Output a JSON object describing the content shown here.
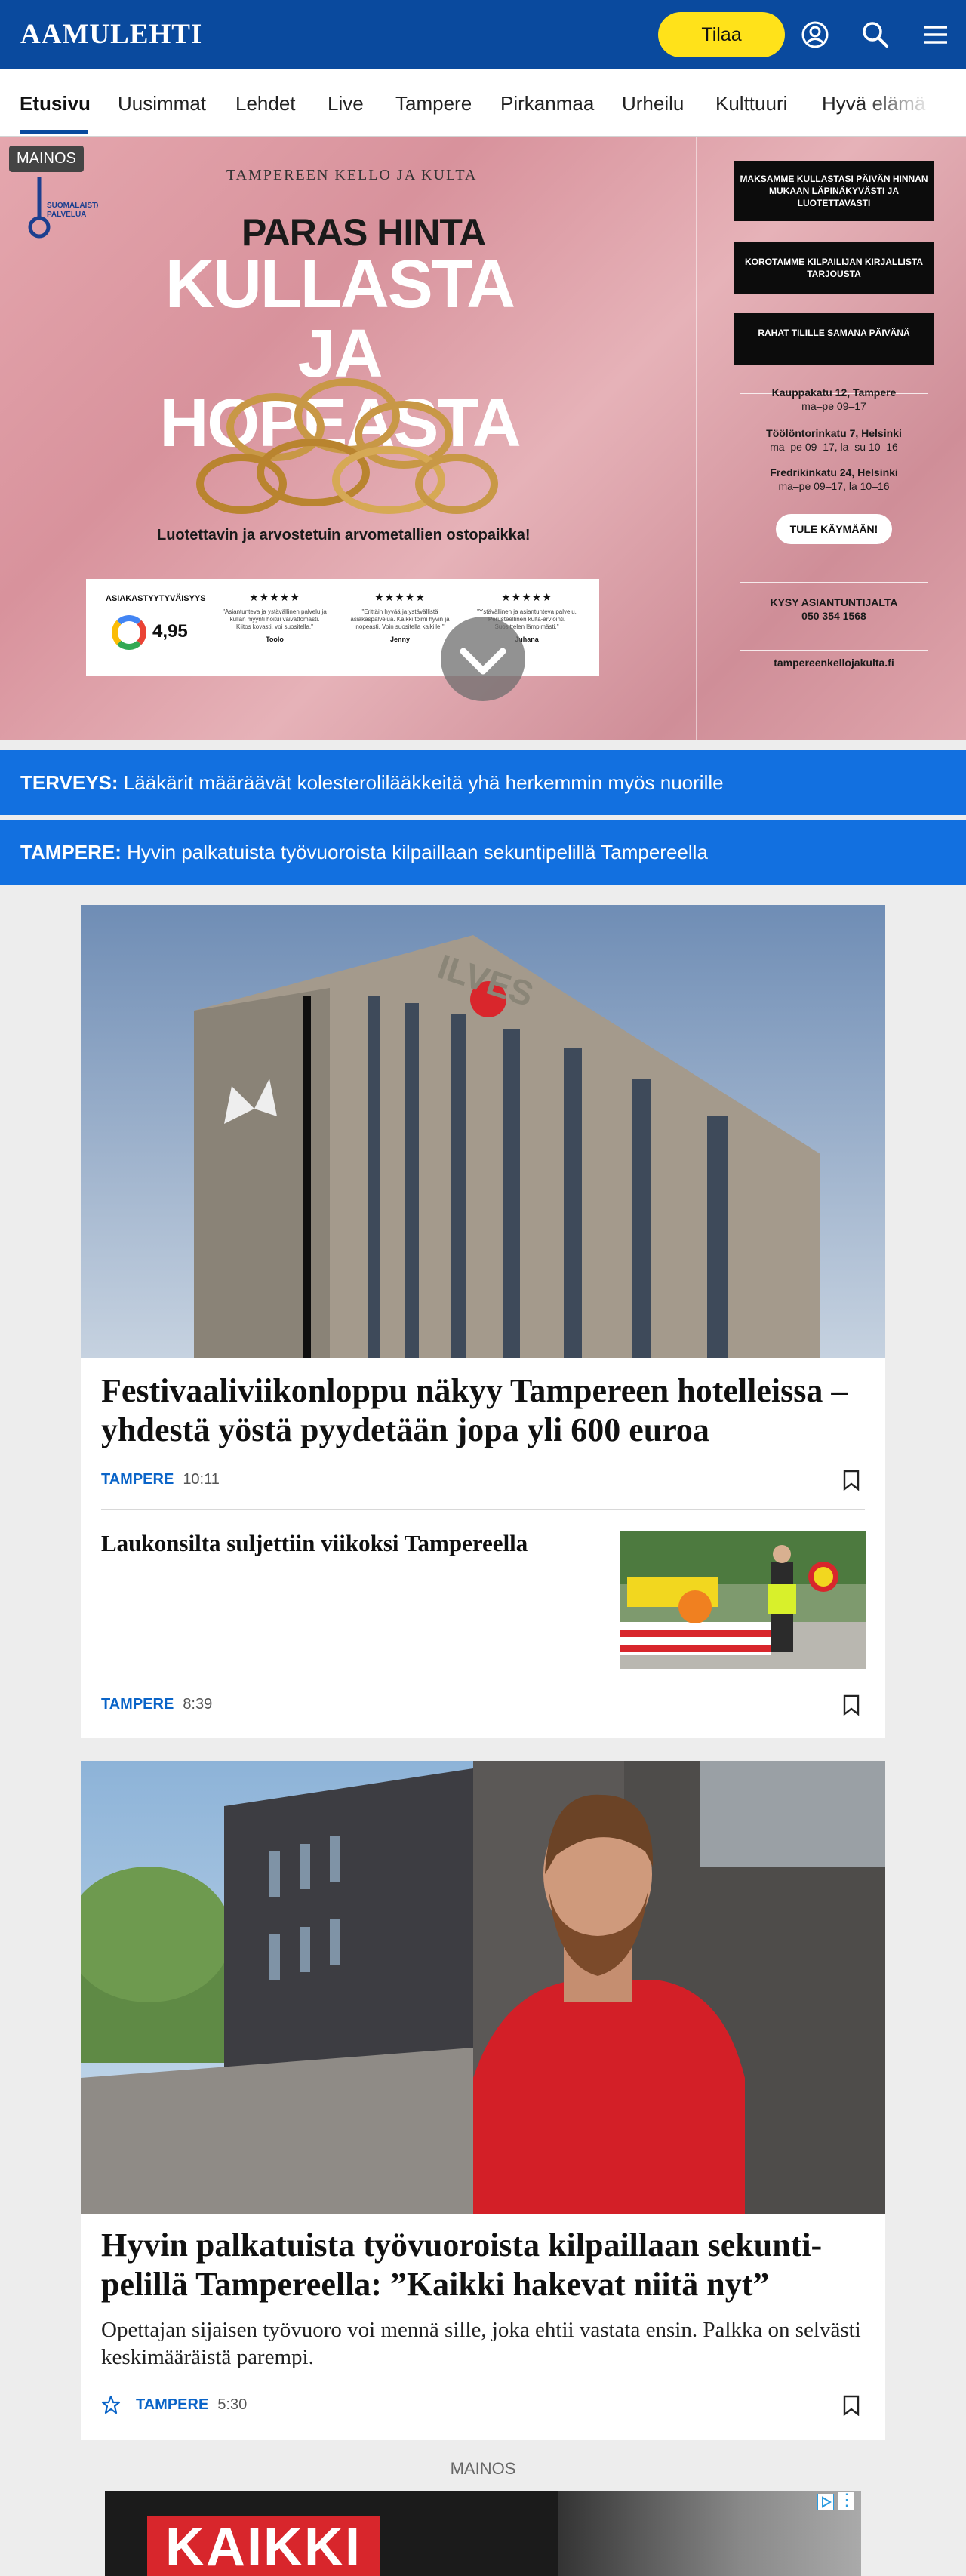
{
  "header": {
    "logo": "AAMULEHTI",
    "subscribe_label": "Tilaa",
    "icons": [
      "user-icon",
      "search-icon",
      "menu-icon"
    ]
  },
  "nav": {
    "items": [
      "Etusivu",
      "Uusimmat",
      "Lehdet",
      "Live",
      "Tampere",
      "Pirkanmaa",
      "Urheilu",
      "Kulttuuri",
      "Hyvä elämä"
    ],
    "active": "Etusivu"
  },
  "ad": {
    "label": "MAINOS",
    "seal_text": [
      "SUOMALAISTA",
      "PALVELUA"
    ],
    "brand": "TAMPEREEN KELLO JA KULTA",
    "headline_small": "PARAS HINTA",
    "headline_big_1": "KULLASTA",
    "headline_big_2": "JA HOPEASTA",
    "tagline": "Luotettavin ja arvostetuin arvometallien ostopaikka!",
    "reviews": {
      "title": "ASIAKASTYYTYVÄISYYS",
      "score": "4,95",
      "stars": "★★★★★",
      "items": [
        {
          "text": "\"Asiantunteva ja ystävällinen palvelu ja kullan myynti hoitui vaivattomasti. Kiitos kovasti, voi suositella.\"",
          "name": "Toolo"
        },
        {
          "text": "\"Erittäin hyvää ja ystävällistä asiakaspalvelua. Kaikki toimi hyvin ja nopeasti. Voin suositella kaikille.\"",
          "name": "Jenny"
        },
        {
          "text": "\"Ystävällinen ja asiantunteva palvelu. Perusteellinen kulta-arviointi. Suosittelen lämpimästi.\"",
          "name": "Juhana"
        }
      ]
    },
    "blocks": [
      "MAKSAMME KULLASTASI PÄIVÄN HINNAN MUKAAN LÄPINÄKYVÄSTI JA LUOTETTAVASTI",
      "KOROTAMME KILPAILIJAN KIRJALLISTA TARJOUSTA",
      "RAHAT TILILLE SAMANA PÄIVÄNÄ"
    ],
    "locations": [
      {
        "address": "Kauppakatu 12, Tampere",
        "hours": "ma–pe 09–17"
      },
      {
        "address": "Töölöntorinkatu 7, Helsinki",
        "hours": "ma–pe 09–17, la–su 10–16"
      },
      {
        "address": "Fredrikinkatu 24, Helsinki",
        "hours": "ma–pe 09–17, la 10–16"
      }
    ],
    "cta": "TULE KÄYMÄÄN!",
    "contact_title": "KYSY ASIANTUNTIJALTA",
    "phone": "050 354 1568",
    "website": "tampereenkellojakulta.fi"
  },
  "tickers": [
    {
      "section": "TERVEYS:",
      "text": " Lääkärit määräävät kolesterolilääkkeitä yhä herkemmin myös nuorille"
    },
    {
      "section": "TAMPERE:",
      "text": " Hyvin palkatuista työvuoroista kilpaillaan sekuntipelillä Tampereella"
    }
  ],
  "articles": [
    {
      "headline_line1": "Festivaaliviikonloppu näkyy Tampereen hotelleissa –",
      "headline_line2": "yhdestä yöstä pyydetään jopa yli 600 euroa",
      "section": "TAMPERE",
      "time": "10:11",
      "image_sign": "ILVES"
    },
    {
      "headline": "Laukonsilta suljettiin viikoksi Tampereella",
      "section": "TAMPERE",
      "time": "8:39"
    },
    {
      "headline_line1": "Hyvin palkatuista työvuoroista kilpaillaan sekunti-",
      "headline_line2": "pelillä Tampereella: ”Kaikki hakevat niitä nyt”",
      "lead": "Opettajan sijaisen työvuoro voi mennä sille, joka ehtii vastata ensin. Palkka on selvästi keskimääräistä parempi.",
      "section": "TAMPERE",
      "time": "5:30"
    }
  ],
  "ad2": {
    "label": "MAINOS",
    "text": "KAIKKI"
  },
  "colors": {
    "header_blue": "#0a4a9e",
    "ticker_blue": "#1270e0",
    "subscribe_yellow": "#ffe21a",
    "section_blue": "#0a64c8"
  }
}
